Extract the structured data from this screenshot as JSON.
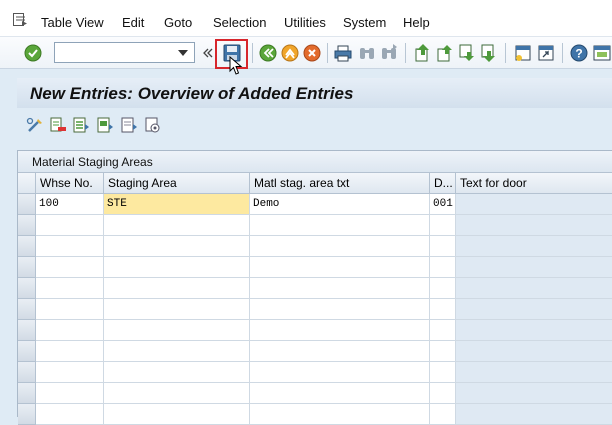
{
  "menubar": {
    "items": [
      "Table View",
      "Edit",
      "Goto",
      "Selection",
      "Utilities",
      "System",
      "Help"
    ]
  },
  "toolbar": {
    "command_field_value": "",
    "buttons": [
      "enter-icon",
      "back-nav-icon",
      "save-icon",
      "back-icon",
      "exit-icon",
      "cancel-icon",
      "print-icon",
      "find-icon",
      "find-next-icon",
      "first-page-icon",
      "previous-page-icon",
      "next-page-icon",
      "last-page-icon",
      "create-session-icon",
      "shortcut-icon",
      "help-icon",
      "customize-layout-icon"
    ]
  },
  "title": "New Entries: Overview of Added Entries",
  "apptoolbar": {
    "buttons": [
      "change-display-icon",
      "delete-icon",
      "select-all-icon",
      "select-block-icon",
      "deselect-all-icon",
      "variant-icon"
    ]
  },
  "table": {
    "caption": "Material Staging Areas",
    "columns": [
      "Whse No.",
      "Staging Area",
      "Matl stag. area txt",
      "D...",
      "Text for door"
    ],
    "rows": [
      [
        "100",
        "STE",
        "Demo",
        "001",
        ""
      ],
      [
        "",
        "",
        "",
        "",
        ""
      ],
      [
        "",
        "",
        "",
        "",
        ""
      ],
      [
        "",
        "",
        "",
        "",
        ""
      ],
      [
        "",
        "",
        "",
        "",
        ""
      ],
      [
        "",
        "",
        "",
        "",
        ""
      ],
      [
        "",
        "",
        "",
        "",
        ""
      ],
      [
        "",
        "",
        "",
        "",
        ""
      ],
      [
        "",
        "",
        "",
        "",
        ""
      ],
      [
        "",
        "",
        "",
        "",
        ""
      ],
      [
        "",
        "",
        "",
        "",
        ""
      ]
    ]
  },
  "colors": {
    "accent_highlight": "#d7262c",
    "editing_cell": "#fde9a0",
    "background": "#dfebf5"
  }
}
